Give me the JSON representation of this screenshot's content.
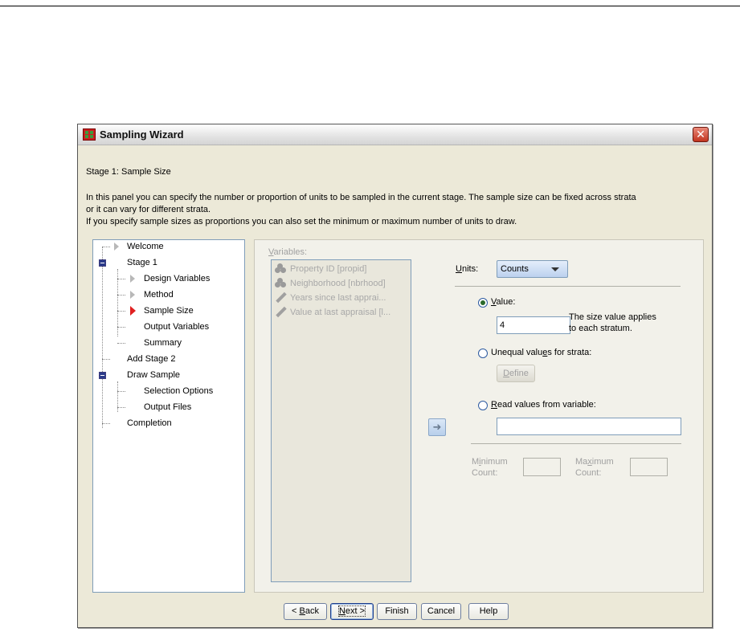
{
  "window": {
    "title": "Sampling Wizard",
    "close_glyph": "✕"
  },
  "header": {
    "stage_title": "Stage 1: Sample Size",
    "description_line1": "In this panel you can specify the number or proportion of units to be sampled in the current stage. The sample size can be fixed across strata",
    "description_line2": "or it can vary for different strata.",
    "description_line3": "If you specify sample sizes as proportions you can also set the minimum or maximum number of units to draw."
  },
  "tree": {
    "items": [
      {
        "label": "Welcome"
      },
      {
        "label": "Stage 1"
      },
      {
        "label": "Design Variables"
      },
      {
        "label": "Method"
      },
      {
        "label": "Sample Size"
      },
      {
        "label": "Output Variables"
      },
      {
        "label": "Summary"
      },
      {
        "label": "Add Stage 2"
      },
      {
        "label": "Draw Sample"
      },
      {
        "label": "Selection Options"
      },
      {
        "label": "Output Files"
      },
      {
        "label": "Completion"
      }
    ],
    "active_item": "Sample Size"
  },
  "variables": {
    "label": "Variables:",
    "items": [
      {
        "label": "Property ID [propid]",
        "icon": "nominal-icon"
      },
      {
        "label": "Neighborhood [nbrhood]",
        "icon": "nominal-icon"
      },
      {
        "label": "Years since last apprai...",
        "icon": "scale-icon"
      },
      {
        "label": "Value at last appraisal [l...",
        "icon": "scale-icon"
      }
    ]
  },
  "move_button": {
    "icon": "arrow-right-icon",
    "glyph": "➜"
  },
  "units": {
    "label": "Units:",
    "selected": "Counts"
  },
  "options": {
    "value_label": "Value:",
    "value_input": "4",
    "value_hint_line1": "The size value applies",
    "value_hint_line2": "to each stratum.",
    "unequal_label": "Unequal values for strata:",
    "define_label": "Define",
    "read_label": "Read values from variable:",
    "read_input": "",
    "selected_option": "value"
  },
  "counts": {
    "min_line1": "Minimum",
    "min_line2": "Count:",
    "max_line1": "Maximum",
    "max_line2": "Count:"
  },
  "buttons": {
    "back": "< Back",
    "next": "Next >",
    "finish": "Finish",
    "cancel": "Cancel",
    "help": "Help"
  },
  "colors": {
    "active_step_marker": "#e02020",
    "window_background": "#ece9d8"
  }
}
